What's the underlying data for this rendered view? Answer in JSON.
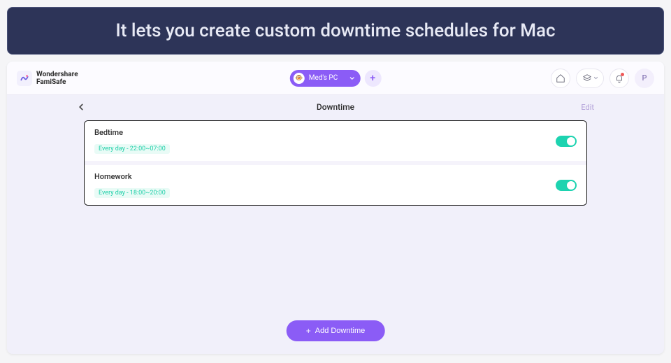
{
  "banner": {
    "text": "It lets you create custom downtime schedules for Mac"
  },
  "brand": {
    "line1": "Wondershare",
    "line2": "FamiSafe"
  },
  "device": {
    "name": "Med's PC",
    "avatar_emoji": "🐵"
  },
  "topbar_right": {
    "profile_initial": "P"
  },
  "page": {
    "title": "Downtime",
    "edit_label": "Edit"
  },
  "schedules": [
    {
      "name": "Bedtime",
      "recurrence": "Every day - 22:00~07:00",
      "enabled": true
    },
    {
      "name": "Homework",
      "recurrence": "Every day - 18:00~20:00",
      "enabled": true
    }
  ],
  "add_button": {
    "label": "Add Downtime"
  },
  "colors": {
    "accent": "#8b5cf6",
    "toggle_on": "#1dd3b0",
    "banner_bg": "#2d3458"
  }
}
